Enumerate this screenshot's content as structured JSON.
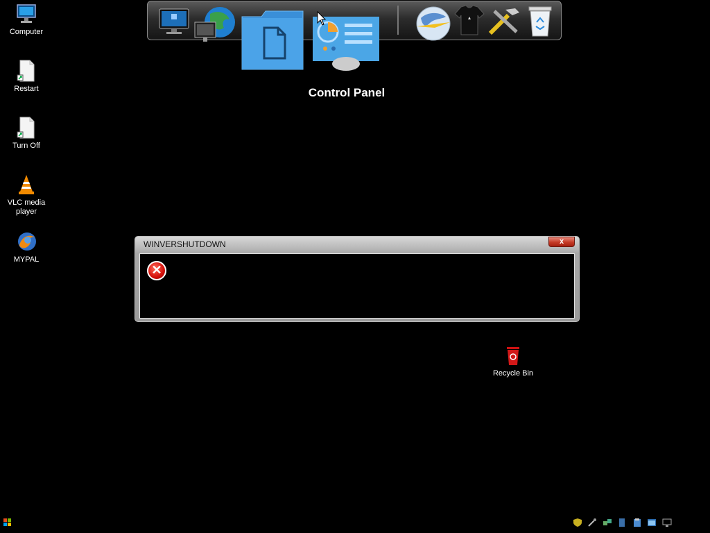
{
  "desktop": {
    "icons": [
      {
        "label": "Computer",
        "icon": "computer-icon"
      },
      {
        "label": "Restart",
        "icon": "shortcut-file-icon"
      },
      {
        "label": "Turn Off",
        "icon": "shortcut-file-icon"
      },
      {
        "label": "VLC media player",
        "icon": "vlc-cone-icon"
      },
      {
        "label": "MYPAL",
        "icon": "mypal-browser-icon"
      },
      {
        "label": "Recycle Bin",
        "icon": "recycle-bin-red-icon"
      }
    ]
  },
  "dock": {
    "hover_label": "Control Panel",
    "items": [
      "monitor-icon",
      "globe-network-icon",
      "folder-icon",
      "control-panel-icon",
      "internet-globe-icon",
      "tshirt-icon",
      "tools-icon",
      "recycle-bin-icon"
    ]
  },
  "dialog": {
    "title": "WINVERSHUTDOWN",
    "close_label": "x",
    "icon": "error-icon",
    "message": ""
  },
  "taskbar": {
    "start": "windows-orb-icon",
    "tray_icons": [
      "shield-icon",
      "tool-icon",
      "network-icon",
      "device-icon",
      "clipboard-icon",
      "window-icon",
      "monitor-tray-icon"
    ]
  },
  "colors": {
    "dialog_close": "#c53a26",
    "error": "#d4100a",
    "desktop_bg": "#000000"
  }
}
